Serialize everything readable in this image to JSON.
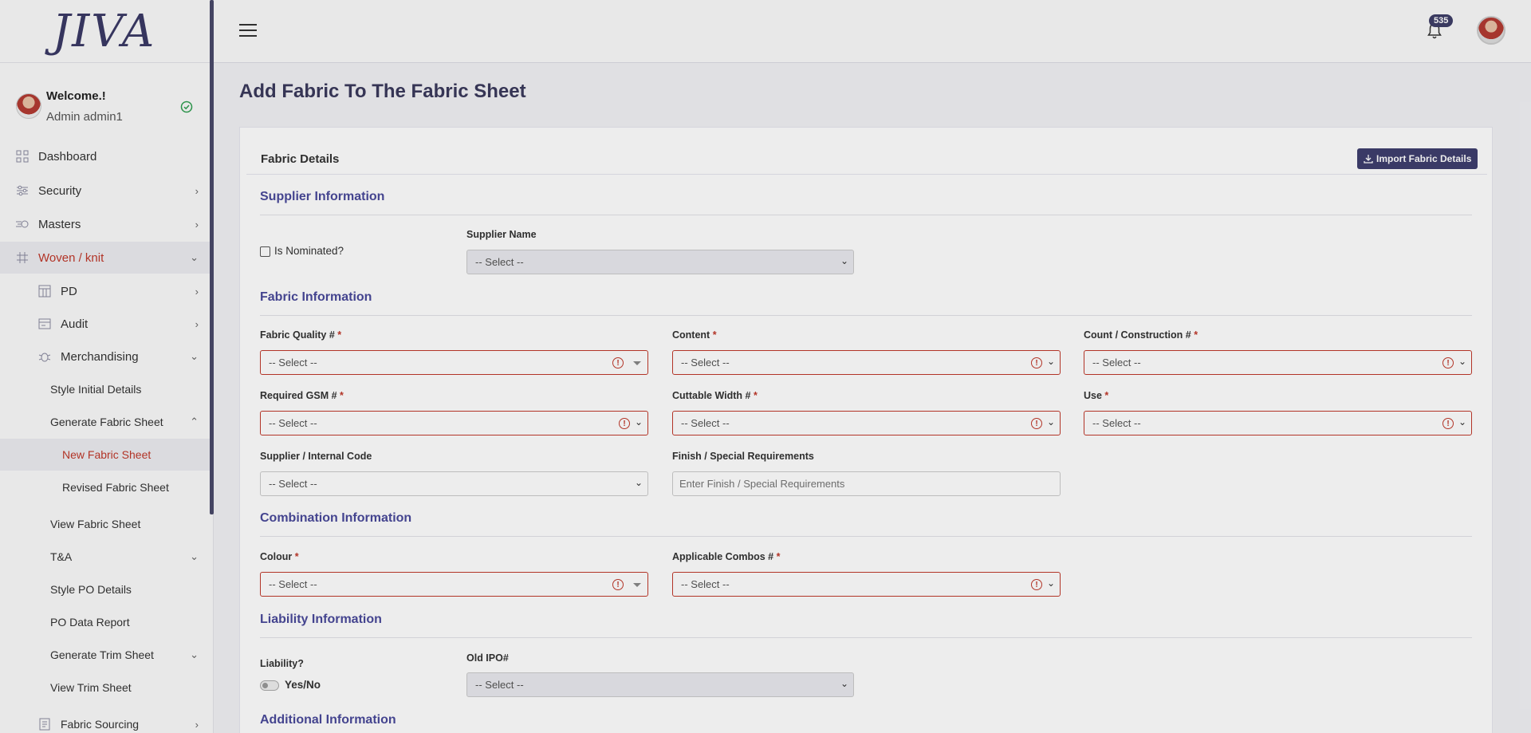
{
  "app": {
    "logo_text": "JIVA"
  },
  "profile": {
    "welcome": "Welcome.!",
    "user": "Admin admin1"
  },
  "sidebar": {
    "items": [
      {
        "label": "Dashboard",
        "icon": "grid-icon"
      },
      {
        "label": "Security",
        "icon": "sliders-icon"
      },
      {
        "label": "Masters",
        "icon": "speed-icon"
      },
      {
        "label": "Woven / knit",
        "icon": "hash-icon"
      },
      {
        "label": "PD",
        "icon": "table-icon"
      },
      {
        "label": "Audit",
        "icon": "card-icon"
      },
      {
        "label": "Merchandising",
        "icon": "bug-icon"
      },
      {
        "label": "Style Initial Details"
      },
      {
        "label": "Generate Fabric Sheet"
      },
      {
        "label": "New Fabric Sheet"
      },
      {
        "label": "Revised Fabric Sheet"
      },
      {
        "label": "View Fabric Sheet"
      },
      {
        "label": "T&A"
      },
      {
        "label": "Style PO Details"
      },
      {
        "label": "PO Data Report"
      },
      {
        "label": "Generate Trim Sheet"
      },
      {
        "label": "View Trim Sheet"
      },
      {
        "label": "Fabric Sourcing",
        "icon": "receipt-icon"
      }
    ]
  },
  "topbar": {
    "notification_count": "535"
  },
  "page": {
    "title": "Add Fabric To The Fabric Sheet"
  },
  "card": {
    "title": "Fabric Details",
    "import_button": "Import Fabric Details"
  },
  "supplier": {
    "section": "Supplier Information",
    "nominated_label": "Is Nominated?",
    "supplier_name_label": "Supplier Name",
    "supplier_name_value": "-- Select --"
  },
  "fabric": {
    "section": "Fabric Information",
    "fields": {
      "quality": {
        "label": "Fabric Quality #",
        "value": "-- Select --"
      },
      "content": {
        "label": "Content",
        "value": "-- Select --"
      },
      "count": {
        "label": "Count / Construction #",
        "value": "-- Select --"
      },
      "gsm": {
        "label": "Required GSM #",
        "value": "-- Select --"
      },
      "width": {
        "label": "Cuttable Width #",
        "value": "-- Select --"
      },
      "use": {
        "label": "Use",
        "value": "-- Select --"
      },
      "supplier_code": {
        "label": "Supplier / Internal Code",
        "value": "-- Select --"
      },
      "finish": {
        "label": "Finish / Special Requirements",
        "placeholder": "Enter Finish / Special Requirements"
      }
    }
  },
  "combination": {
    "section": "Combination Information",
    "colour": {
      "label": "Colour ",
      "value": "-- Select --"
    },
    "combos": {
      "label": "Applicable Combos #",
      "value": "-- Select --"
    }
  },
  "liability": {
    "section": "Liability Information",
    "label": "Liability?",
    "toggle_label": "Yes/No",
    "old_ipo_label": "Old IPO#",
    "old_ipo_value": "-- Select --"
  },
  "additional": {
    "section": "Additional Information"
  },
  "required_mark": "*",
  "error_mark": "!",
  "colors": {
    "accent": "#3f3f6e",
    "section": "#4a4a9a",
    "error": "#c0392b"
  }
}
